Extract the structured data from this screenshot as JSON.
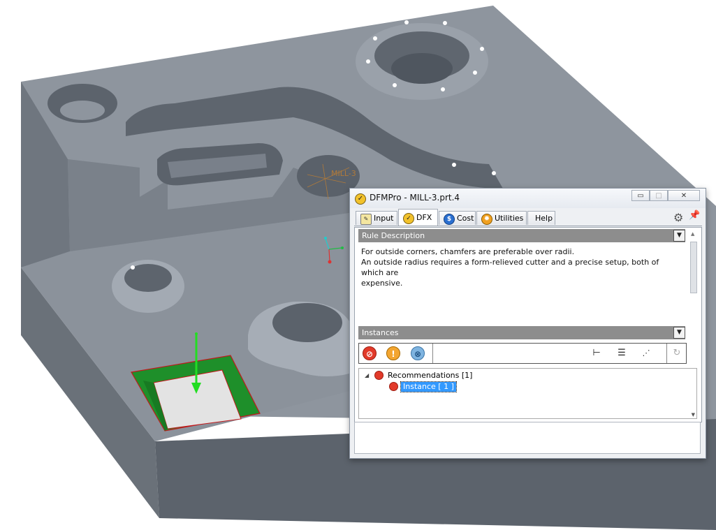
{
  "cad": {
    "part_label": "MILL-3"
  },
  "window": {
    "title": "DFMPro - MILL-3.prt.4",
    "minimize_glyph": "▭",
    "restore_glyph": "□",
    "close_glyph": "✕"
  },
  "tabs": [
    {
      "label": "Input",
      "icon": "input-icon"
    },
    {
      "label": "DFX",
      "icon": "dfx-icon",
      "active": true
    },
    {
      "label": "Cost",
      "icon": "cost-icon"
    },
    {
      "label": "Utilities",
      "icon": "utilities-icon"
    },
    {
      "label": "Help",
      "icon": "none"
    }
  ],
  "rule_description": {
    "header": "Rule Description",
    "lines": [
      "For outside corners, chamfers are preferable over radii.",
      "An outside radius requires a form-relieved cutter and a precise setup, both of which are",
      "expensive."
    ]
  },
  "instances": {
    "header": "Instances",
    "toolbar_icons": [
      "recommendation-filter-icon",
      "warning-filter-icon",
      "ignore-filter-icon",
      "tree-view-icon",
      "list-view-icon",
      "chart-view-icon",
      "refresh-icon"
    ],
    "tree": {
      "group_label": "Recommendations [1]",
      "item_label": "Instance [ 1 ]"
    }
  },
  "colors": {
    "model_face": "#8e959e",
    "highlight_green": "#1e8f2a",
    "section_header": "#8d8d8d",
    "selection_blue": "#3399ff"
  }
}
